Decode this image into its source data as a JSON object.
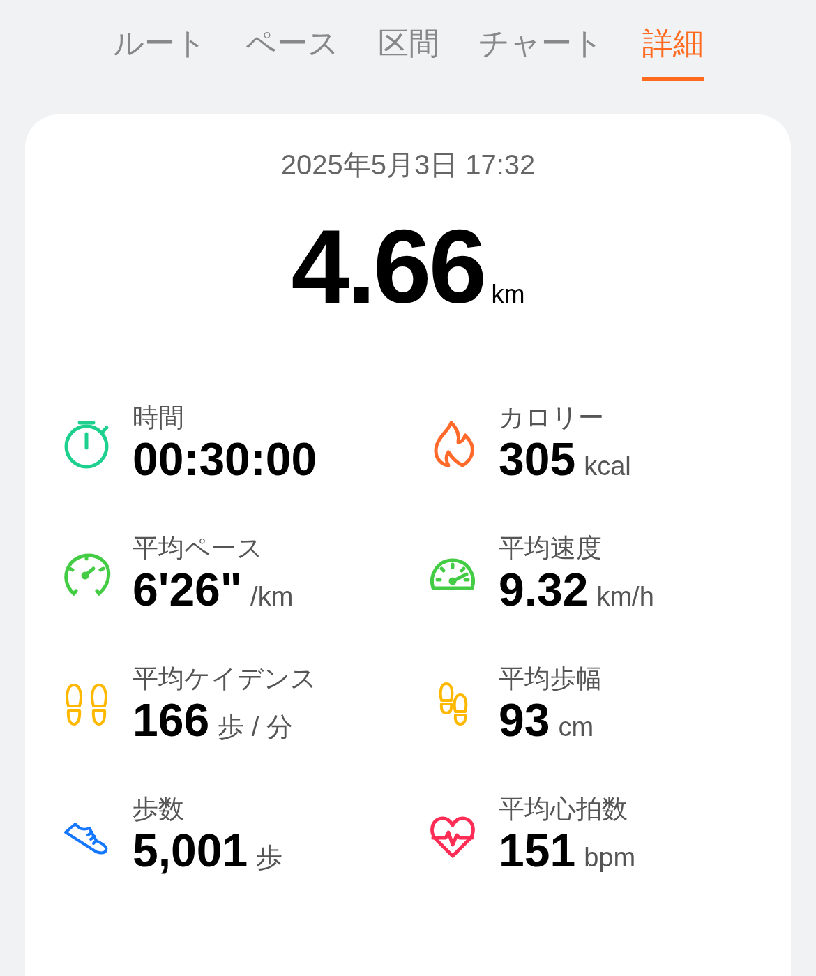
{
  "tabs": [
    {
      "label": "ルート",
      "selected": false
    },
    {
      "label": "ペース",
      "selected": false
    },
    {
      "label": "区間",
      "selected": false
    },
    {
      "label": "チャート",
      "selected": false
    },
    {
      "label": "詳細",
      "selected": true
    }
  ],
  "summary": {
    "date": "2025年5月3日 17:32",
    "distance": "4.66",
    "distance_unit": "km"
  },
  "stats": [
    {
      "kind": "stopwatch",
      "color": "#1ed08e",
      "label": "時間",
      "value": "00:30:00"
    },
    {
      "kind": "flame",
      "color": "#ff6a2a",
      "label": "カロリー",
      "value": "305",
      "unit": "kcal"
    },
    {
      "kind": "gauge",
      "color": "#44cc44",
      "label": "平均ペース",
      "value": "6'26\"",
      "unit": "/km"
    },
    {
      "kind": "speedometer",
      "color": "#44cc44",
      "label": "平均速度",
      "value": "9.32",
      "unit": "km/h"
    },
    {
      "kind": "footprints",
      "color": "#ffb800",
      "label": "平均ケイデンス",
      "value": "166",
      "unit": "歩 / 分"
    },
    {
      "kind": "steps",
      "color": "#ffb800",
      "label": "平均歩幅",
      "value": "93",
      "unit": "cm"
    },
    {
      "kind": "shoe",
      "color": "#1677ff",
      "label": "歩数",
      "value": "5,001",
      "unit": "歩"
    },
    {
      "kind": "heart",
      "color": "#ff2d55",
      "label": "平均心拍数",
      "value": "151",
      "unit": "bpm"
    }
  ]
}
